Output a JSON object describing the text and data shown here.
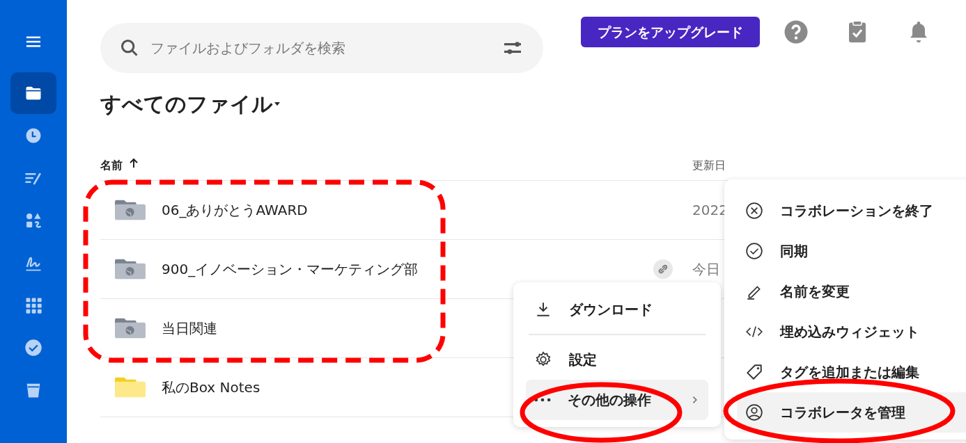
{
  "sidebar": {
    "items": [
      {
        "kind": "menu",
        "selected": false
      },
      {
        "kind": "folder",
        "selected": true
      },
      {
        "kind": "clock",
        "selected": false
      },
      {
        "kind": "notes",
        "selected": false
      },
      {
        "kind": "shapes",
        "selected": false
      },
      {
        "kind": "sign",
        "selected": false
      },
      {
        "kind": "grid",
        "selected": false
      },
      {
        "kind": "check",
        "selected": false
      },
      {
        "kind": "trash",
        "selected": false
      }
    ]
  },
  "search": {
    "placeholder": "ファイルおよびフォルダを検索"
  },
  "upgrade_button": "プランをアップグレード",
  "title": "すべてのファイル",
  "table": {
    "columns": [
      {
        "label": "名前",
        "sorted": true
      },
      {
        "label": "更新日",
        "sorted": false
      }
    ],
    "rows": [
      {
        "kind": "shared",
        "name": "06_ありがとうAWARD",
        "date": "2022",
        "link": false
      },
      {
        "kind": "shared",
        "name": "900_イノベーション・マーケティング部",
        "date": "今日",
        "link": true
      },
      {
        "kind": "shared",
        "name": "当日関連",
        "link": false
      },
      {
        "kind": "personal",
        "name": "私のBox Notes",
        "link": false
      }
    ]
  },
  "context_menu": {
    "items": [
      {
        "kind": "download",
        "label": "ダウンロード",
        "selected": false
      },
      {
        "kind": "divider"
      },
      {
        "kind": "gear",
        "label": "設定",
        "selected": false
      },
      {
        "kind": "more",
        "label": "その他の操作",
        "selected": true
      }
    ]
  },
  "submenu": {
    "items": [
      {
        "kind": "remove",
        "label": "コラボレーションを終了",
        "selected": false
      },
      {
        "kind": "sync",
        "label": "同期",
        "selected": false
      },
      {
        "kind": "rename",
        "label": "名前を変更",
        "selected": false
      },
      {
        "kind": "embed",
        "label": "埋め込みウィジェット",
        "selected": false
      },
      {
        "kind": "tag",
        "label": "タグを追加または編集",
        "selected": false
      },
      {
        "kind": "collab",
        "label": "コラボレータを管理",
        "selected": true
      }
    ]
  },
  "annotations": [
    {
      "kind": "dashed-box"
    },
    {
      "kind": "ellipse"
    },
    {
      "kind": "ellipse"
    }
  ]
}
